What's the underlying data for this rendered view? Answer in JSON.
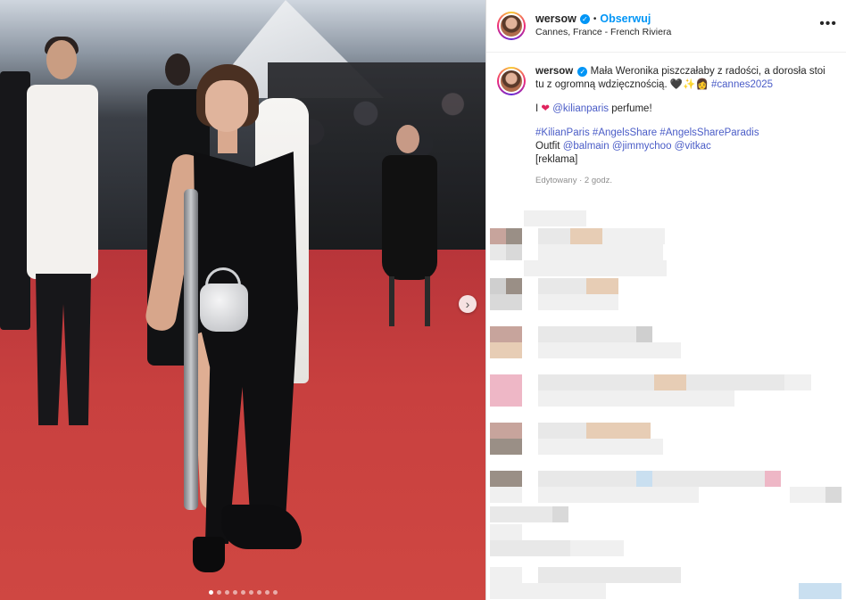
{
  "post": {
    "carousel": {
      "total_slides": 9,
      "active_index": 0,
      "next_label": "›"
    },
    "header": {
      "username": "wersow",
      "verified_glyph": "✓",
      "separator": "•",
      "follow_label": "Obserwuj",
      "location": "Cannes, France - French Riviera",
      "more_label": "•••"
    },
    "caption": {
      "username": "wersow",
      "verified_glyph": "✓",
      "text": "Mała Weronika piszczałaby z radości, a dorosła stoi tu z ogromną wdzięcznością. 🖤✨👩",
      "hashtag_main": "#cannes2025",
      "line2_prefix": "I",
      "line2_heart": "❤",
      "line2_mention": "@kilianparis",
      "line2_suffix": "perfume!",
      "hashtags": "#KilianParis #AngelsShare #AngelsShareParadis",
      "outfit_label": "Outfit",
      "outfit_mentions": "@balmain @jimmychoo @vitkac",
      "ad_label": "[reklama]",
      "edited": "Edytowany · 2 godz."
    },
    "icons": {
      "avatar": "avatar-photo",
      "verified": "verified-badge-icon",
      "more": "more-options-icon",
      "next": "chevron-right-icon"
    },
    "colors": {
      "accent_blue": "#0095f6",
      "hashtag_blue": "#4a5cc7",
      "red_carpet": "#c8403f"
    }
  }
}
